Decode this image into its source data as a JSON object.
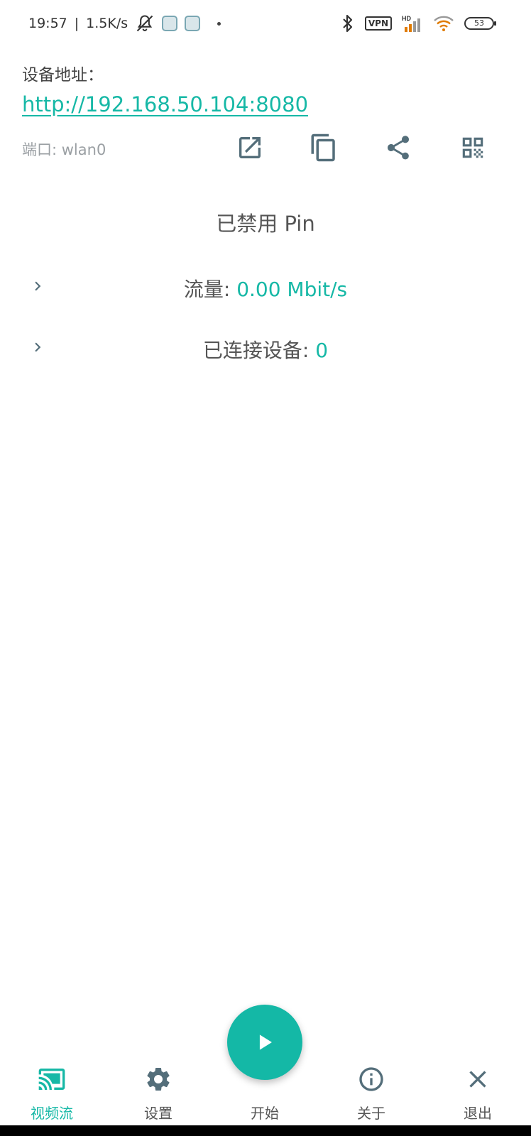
{
  "status_bar": {
    "time": "19:57",
    "separator": "|",
    "speed": "1.5K/s",
    "vpn": "VPN",
    "signal_tag": "HD",
    "battery": "53"
  },
  "address": {
    "label": "设备地址：",
    "url": "http://192.168.50.104:8080",
    "port": "端口: wlan0"
  },
  "actions": {
    "open_icon": "open-in-new-icon",
    "copy_icon": "copy-icon",
    "share_icon": "share-icon",
    "qr_icon": "qr-code-icon"
  },
  "status": {
    "pin": "已禁用 Pin",
    "traffic_label": "流量: ",
    "traffic_value": "0.00 Mbit/s",
    "clients_label": "已连接设备: ",
    "clients_value": "0"
  },
  "bottom_nav": {
    "stream": "视频流",
    "settings": "设置",
    "start": "开始",
    "about": "关于",
    "exit": "退出"
  },
  "colors": {
    "accent": "#16b8a6",
    "icon": "#546e7a",
    "text": "#555555"
  }
}
